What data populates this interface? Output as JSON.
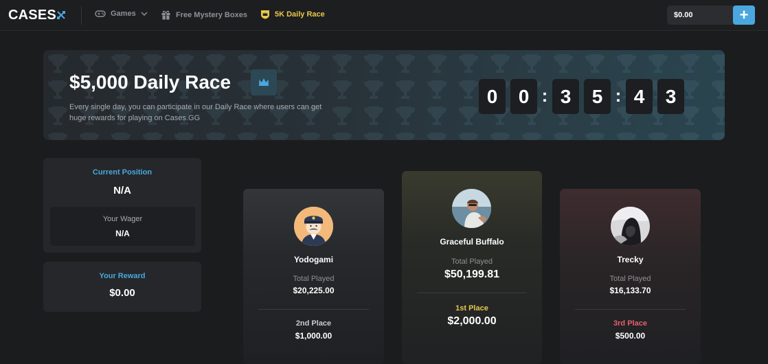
{
  "nav": {
    "logo": "CASES",
    "games_label": "Games",
    "boxes_label": "Free Mystery Boxes",
    "race_label": "5K Daily Race",
    "balance": "$0.00",
    "deposit_symbol": "+",
    "accent_color": "#4aa8df",
    "active_color": "#e8c84a",
    "icons": [
      "swords-icon",
      "gamepad-icon",
      "chevron-down-icon",
      "gift-icon",
      "crown-shield-icon",
      "plus-icon"
    ]
  },
  "hero": {
    "title": "$5,000 Daily Race",
    "description": "Every single day, you can participate in our Daily Race where users can get huge rewards for playing on Cases.GG",
    "timer": {
      "digits": [
        "0",
        "0",
        "3",
        "5",
        "4",
        "3"
      ],
      "separator": ":"
    },
    "badge_icon": "crown-icon"
  },
  "stats": {
    "current_position_label": "Current Position",
    "current_position_value": "N/A",
    "wager_label": "Your Wager",
    "wager_value": "N/A",
    "reward_label": "Your Reward",
    "reward_value": "$0.00"
  },
  "podium": {
    "first": {
      "name": "Graceful Buffalo",
      "played_label": "Total Played",
      "played_value": "$50,199.81",
      "place": "1st Place",
      "prize": "$2,000.00",
      "place_color": "#e8c84a"
    },
    "second": {
      "name": "Yodogami",
      "played_label": "Total Played",
      "played_value": "$20,225.00",
      "place": "2nd Place",
      "prize": "$1,000.00",
      "place_color": "#c7cbd0"
    },
    "third": {
      "name": "Trecky",
      "played_label": "Total Played",
      "played_value": "$16,133.70",
      "place": "3rd Place",
      "prize": "$500.00",
      "place_color": "#e0626e"
    }
  }
}
